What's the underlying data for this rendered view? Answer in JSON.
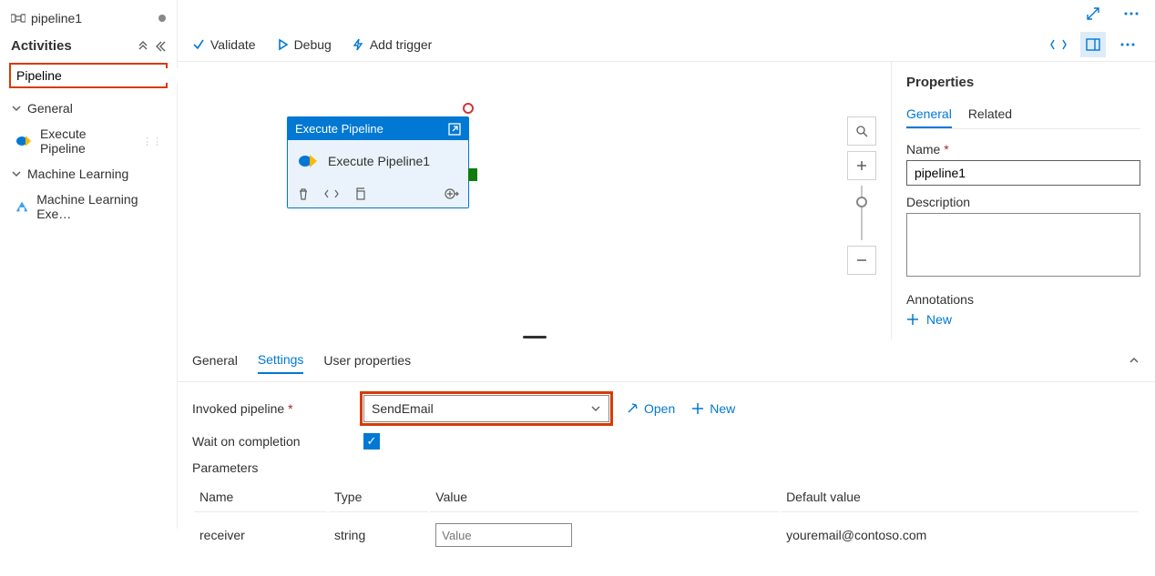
{
  "tab": {
    "name": "pipeline1"
  },
  "sidebar": {
    "title": "Activities",
    "search_value": "Pipeline",
    "groups": [
      {
        "label": "General",
        "items": [
          {
            "label": "Execute Pipeline"
          }
        ]
      },
      {
        "label": "Machine Learning",
        "items": [
          {
            "label": "Machine Learning Exe…"
          }
        ]
      }
    ]
  },
  "actions": {
    "validate": "Validate",
    "debug": "Debug",
    "add_trigger": "Add trigger"
  },
  "node": {
    "type": "Execute Pipeline",
    "name": "Execute Pipeline1"
  },
  "bottom": {
    "tabs": {
      "general": "General",
      "settings": "Settings",
      "user_properties": "User properties"
    },
    "invoked_label": "Invoked pipeline",
    "invoked_value": "SendEmail",
    "open": "Open",
    "new": "New",
    "wait_label": "Wait on completion",
    "parameters_label": "Parameters",
    "table": {
      "headers": {
        "name": "Name",
        "type": "Type",
        "value": "Value",
        "default": "Default value"
      },
      "rows": [
        {
          "name": "receiver",
          "type": "string",
          "value_placeholder": "Value",
          "default": "youremail@contoso.com"
        }
      ]
    }
  },
  "props": {
    "title": "Properties",
    "tabs": {
      "general": "General",
      "related": "Related"
    },
    "name_label": "Name",
    "name_value": "pipeline1",
    "desc_label": "Description",
    "annotations_label": "Annotations",
    "new": "New"
  }
}
